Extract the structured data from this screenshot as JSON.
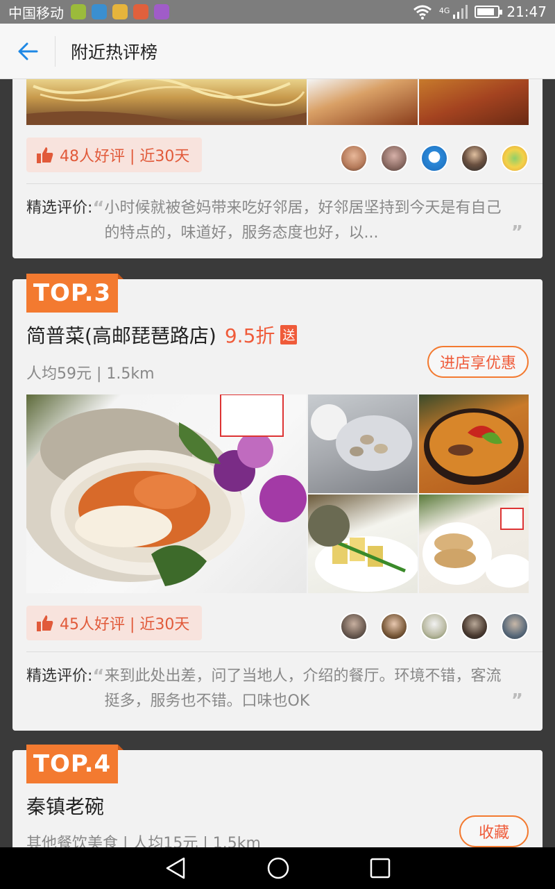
{
  "status_bar": {
    "carrier": "中国移动",
    "network": "4G",
    "time": "21:47"
  },
  "header": {
    "title": "附近热评榜"
  },
  "cards": [
    {
      "likes_text": "48人好评 | 近30天",
      "review_label": "精选评价:",
      "review_text": "小时候就被爸妈带来吃好邻居，好邻居坚持到今天是有自己的特点的，味道好，服务态度也好，以..."
    },
    {
      "rank": "TOP.3",
      "name": "简普菜(高邮琵琶路店)",
      "discount": "9.5折",
      "gift_tag": "送",
      "meta": "人均59元 | 1.5km",
      "action_button": "进店享优惠",
      "likes_text": "45人好评 | 近30天",
      "review_label": "精选评价:",
      "review_text": "来到此处出差，问了当地人，介绍的餐厅。环境不错，客流挺多，服务也不错。口味也OK"
    },
    {
      "rank": "TOP.4",
      "name": "秦镇老碗",
      "meta": "其他餐饮美食 | 人均15元 | 1.5km",
      "action_button": "收藏"
    }
  ],
  "colors": {
    "accent": "#f37a30",
    "highlight": "#ef5b3a",
    "like_bg": "#f8e3dd"
  }
}
